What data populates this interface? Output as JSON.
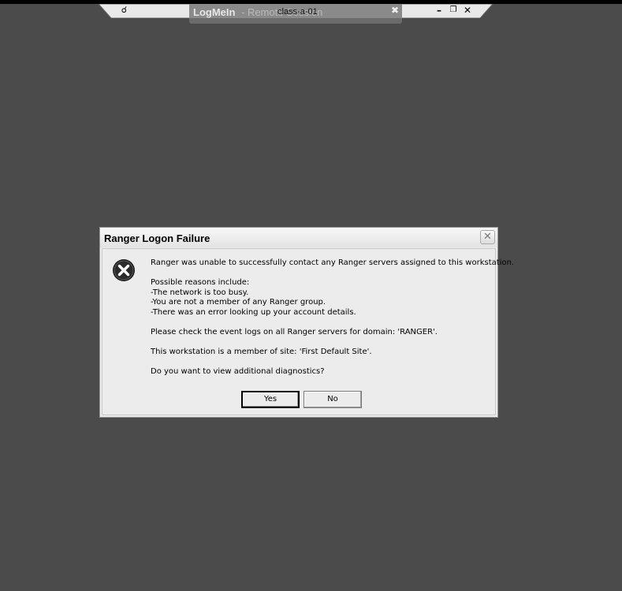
{
  "remote_bar": {
    "brand": "LogMeIn",
    "brand_sub": "- Remote Session",
    "host": "class-a-01",
    "tab_close_icon": "close-icon",
    "pin_icon": "pin-icon",
    "minimize_icon": "minimize-icon",
    "restore_icon": "restore-icon",
    "close_icon": "close-icon"
  },
  "dialog": {
    "title": "Ranger Logon Failure",
    "icon": "error-icon",
    "message_lines": [
      "Ranger was unable to successfully contact any Ranger servers assigned to this workstation.",
      "",
      "Possible reasons include:",
      "-The network is too busy.",
      "-You are not a member of any Ranger group.",
      "-There was an error looking up your account details.",
      "",
      "Please check the event logs on all Ranger servers for domain: 'RANGER'.",
      "",
      "This workstation is a member of site: 'First Default Site'.",
      "",
      "Do you want to view additional diagnostics?"
    ],
    "yes_label": "Yes",
    "no_label": "No"
  }
}
